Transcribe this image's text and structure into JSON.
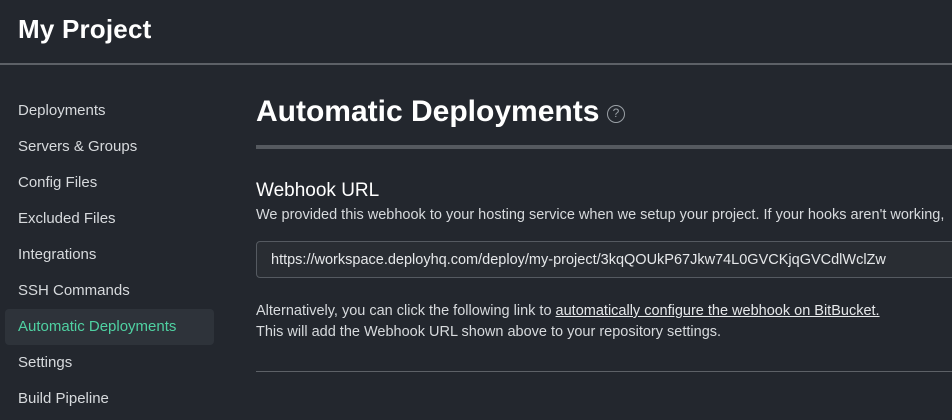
{
  "header": {
    "title": "My Project"
  },
  "sidebar": {
    "items": [
      {
        "label": "Deployments",
        "active": false
      },
      {
        "label": "Servers & Groups",
        "active": false
      },
      {
        "label": "Config Files",
        "active": false
      },
      {
        "label": "Excluded Files",
        "active": false
      },
      {
        "label": "Integrations",
        "active": false
      },
      {
        "label": "SSH Commands",
        "active": false
      },
      {
        "label": "Automatic Deployments",
        "active": true
      },
      {
        "label": "Settings",
        "active": false
      },
      {
        "label": "Build Pipeline",
        "active": false
      }
    ]
  },
  "main": {
    "title": "Automatic Deployments",
    "help_icon": "question-circle",
    "webhook": {
      "label": "Webhook URL",
      "description": "We provided this webhook to your hosting service when we setup your project. If your hooks aren't working,",
      "url": "https://workspace.deployhq.com/deploy/my-project/3kqQOUkP67Jkw74L0GVCKjqGVCdlWclZw"
    },
    "alternative": {
      "prefix": "Alternatively, you can click the following link to ",
      "link": "automatically configure the webhook on BitBucket.",
      "note": "This will add the Webhook URL shown above to your repository settings."
    }
  },
  "colors": {
    "background": "#23272e",
    "active_accent": "#4fd1a2",
    "active_bg": "#2e333a"
  }
}
